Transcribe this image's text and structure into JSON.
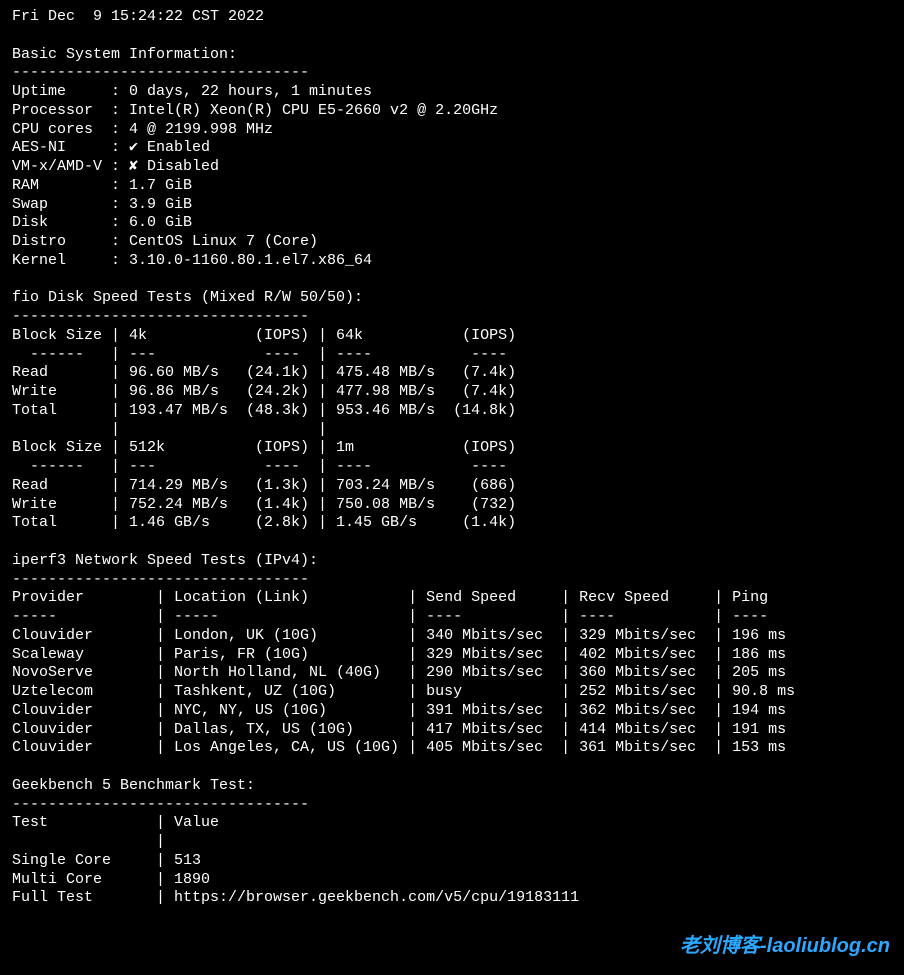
{
  "timestamp": "Fri Dec  9 15:24:22 CST 2022",
  "sections": {
    "sysinfo": {
      "title": "Basic System Information:",
      "rows": [
        {
          "label": "Uptime",
          "value": "0 days, 22 hours, 1 minutes"
        },
        {
          "label": "Processor",
          "value": "Intel(R) Xeon(R) CPU E5-2660 v2 @ 2.20GHz"
        },
        {
          "label": "CPU cores",
          "value": "4 @ 2199.998 MHz"
        },
        {
          "label": "AES-NI",
          "value": "✔ Enabled"
        },
        {
          "label": "VM-x/AMD-V",
          "value": "✘ Disabled"
        },
        {
          "label": "RAM",
          "value": "1.7 GiB"
        },
        {
          "label": "Swap",
          "value": "3.9 GiB"
        },
        {
          "label": "Disk",
          "value": "6.0 GiB"
        },
        {
          "label": "Distro",
          "value": "CentOS Linux 7 (Core)"
        },
        {
          "label": "Kernel",
          "value": "3.10.0-1160.80.1.el7.x86_64"
        }
      ]
    },
    "fio": {
      "title": "fio Disk Speed Tests (Mixed R/W 50/50):",
      "header1": {
        "c1": "Block Size",
        "c2": "4k",
        "c3": "(IOPS)",
        "c4": "64k",
        "c5": "(IOPS)"
      },
      "set1": [
        {
          "label": "Read",
          "a": "96.60 MB/s",
          "ai": "(24.1k)",
          "b": "475.48 MB/s",
          "bi": "(7.4k)"
        },
        {
          "label": "Write",
          "a": "96.86 MB/s",
          "ai": "(24.2k)",
          "b": "477.98 MB/s",
          "bi": "(7.4k)"
        },
        {
          "label": "Total",
          "a": "193.47 MB/s",
          "ai": "(48.3k)",
          "b": "953.46 MB/s",
          "bi": "(14.8k)"
        }
      ],
      "header2": {
        "c1": "Block Size",
        "c2": "512k",
        "c3": "(IOPS)",
        "c4": "1m",
        "c5": "(IOPS)"
      },
      "set2": [
        {
          "label": "Read",
          "a": "714.29 MB/s",
          "ai": "(1.3k)",
          "b": "703.24 MB/s",
          "bi": "(686)"
        },
        {
          "label": "Write",
          "a": "752.24 MB/s",
          "ai": "(1.4k)",
          "b": "750.08 MB/s",
          "bi": "(732)"
        },
        {
          "label": "Total",
          "a": "1.46 GB/s",
          "ai": "(2.8k)",
          "b": "1.45 GB/s",
          "bi": "(1.4k)"
        }
      ]
    },
    "iperf": {
      "title": "iperf3 Network Speed Tests (IPv4):",
      "header": {
        "provider": "Provider",
        "location": "Location (Link)",
        "send": "Send Speed",
        "recv": "Recv Speed",
        "ping": "Ping"
      },
      "rows": [
        {
          "provider": "Clouvider",
          "location": "London, UK (10G)",
          "send": "340 Mbits/sec",
          "recv": "329 Mbits/sec",
          "ping": "196 ms"
        },
        {
          "provider": "Scaleway",
          "location": "Paris, FR (10G)",
          "send": "329 Mbits/sec",
          "recv": "402 Mbits/sec",
          "ping": "186 ms"
        },
        {
          "provider": "NovoServe",
          "location": "North Holland, NL (40G)",
          "send": "290 Mbits/sec",
          "recv": "360 Mbits/sec",
          "ping": "205 ms"
        },
        {
          "provider": "Uztelecom",
          "location": "Tashkent, UZ (10G)",
          "send": "busy",
          "recv": "252 Mbits/sec",
          "ping": "90.8 ms"
        },
        {
          "provider": "Clouvider",
          "location": "NYC, NY, US (10G)",
          "send": "391 Mbits/sec",
          "recv": "362 Mbits/sec",
          "ping": "194 ms"
        },
        {
          "provider": "Clouvider",
          "location": "Dallas, TX, US (10G)",
          "send": "417 Mbits/sec",
          "recv": "414 Mbits/sec",
          "ping": "191 ms"
        },
        {
          "provider": "Clouvider",
          "location": "Los Angeles, CA, US (10G)",
          "send": "405 Mbits/sec",
          "recv": "361 Mbits/sec",
          "ping": "153 ms"
        }
      ]
    },
    "geekbench": {
      "title": "Geekbench 5 Benchmark Test:",
      "header": {
        "test": "Test",
        "value": "Value"
      },
      "rows": [
        {
          "test": "Single Core",
          "value": "513"
        },
        {
          "test": "Multi Core",
          "value": "1890"
        },
        {
          "test": "Full Test",
          "value": "https://browser.geekbench.com/v5/cpu/19183111"
        }
      ]
    }
  },
  "watermark": "老刘博客-laoliublog.cn"
}
